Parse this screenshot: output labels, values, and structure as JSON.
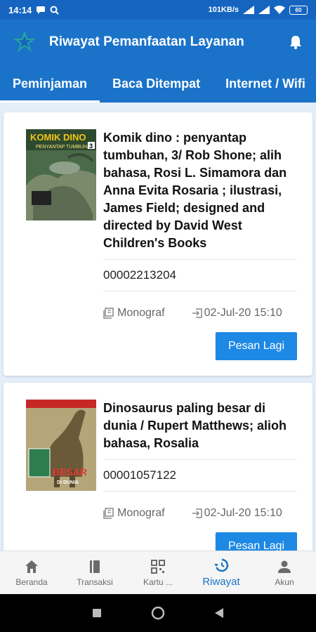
{
  "status_bar": {
    "time": "14:14",
    "speed": "101KB/s",
    "battery": "60"
  },
  "app": {
    "title": "Riwayat Pemanfaatan Layanan"
  },
  "tabs": [
    {
      "label": "Peminjaman"
    },
    {
      "label": "Baca Ditempat"
    },
    {
      "label": "Internet / Wifi"
    }
  ],
  "items": [
    {
      "title": "Komik dino : penyantap tumbuhan, 3/ Rob Shone; alih bahasa, Rosi L. Simamora dan Anna Evita Rosaria ; ilustrasi, James Field; designed and directed by David West Children's Books",
      "code": "00002213204",
      "type": "Monograf",
      "date": "02-Jul-20 15:10",
      "button": "Pesan Lagi",
      "cover_text": "KOMIK DINO",
      "cover_sub": "PENYANTAP TUMBUHAN",
      "cover_num": "3"
    },
    {
      "title": "Dinosaurus paling besar di dunia / Rupert Matthews; alioh bahasa, Rosalia",
      "code": "00001057122",
      "type": "Monograf",
      "date": "02-Jul-20 15:10",
      "button": "Pesan Lagi",
      "cover_text": "BESAR",
      "cover_sub": "DI DUNIA"
    }
  ],
  "bottom_nav": [
    {
      "label": "Beranda",
      "icon": "home-icon"
    },
    {
      "label": "Transaksi",
      "icon": "book-icon"
    },
    {
      "label": "Kartu ...",
      "icon": "qr-code-icon"
    },
    {
      "label": "Riwayat",
      "icon": "history-icon",
      "active": true
    },
    {
      "label": "Akun",
      "icon": "person-icon"
    }
  ],
  "colors": {
    "primary": "#1a73c9",
    "button": "#1e88e5",
    "background": "#e4eef8"
  }
}
